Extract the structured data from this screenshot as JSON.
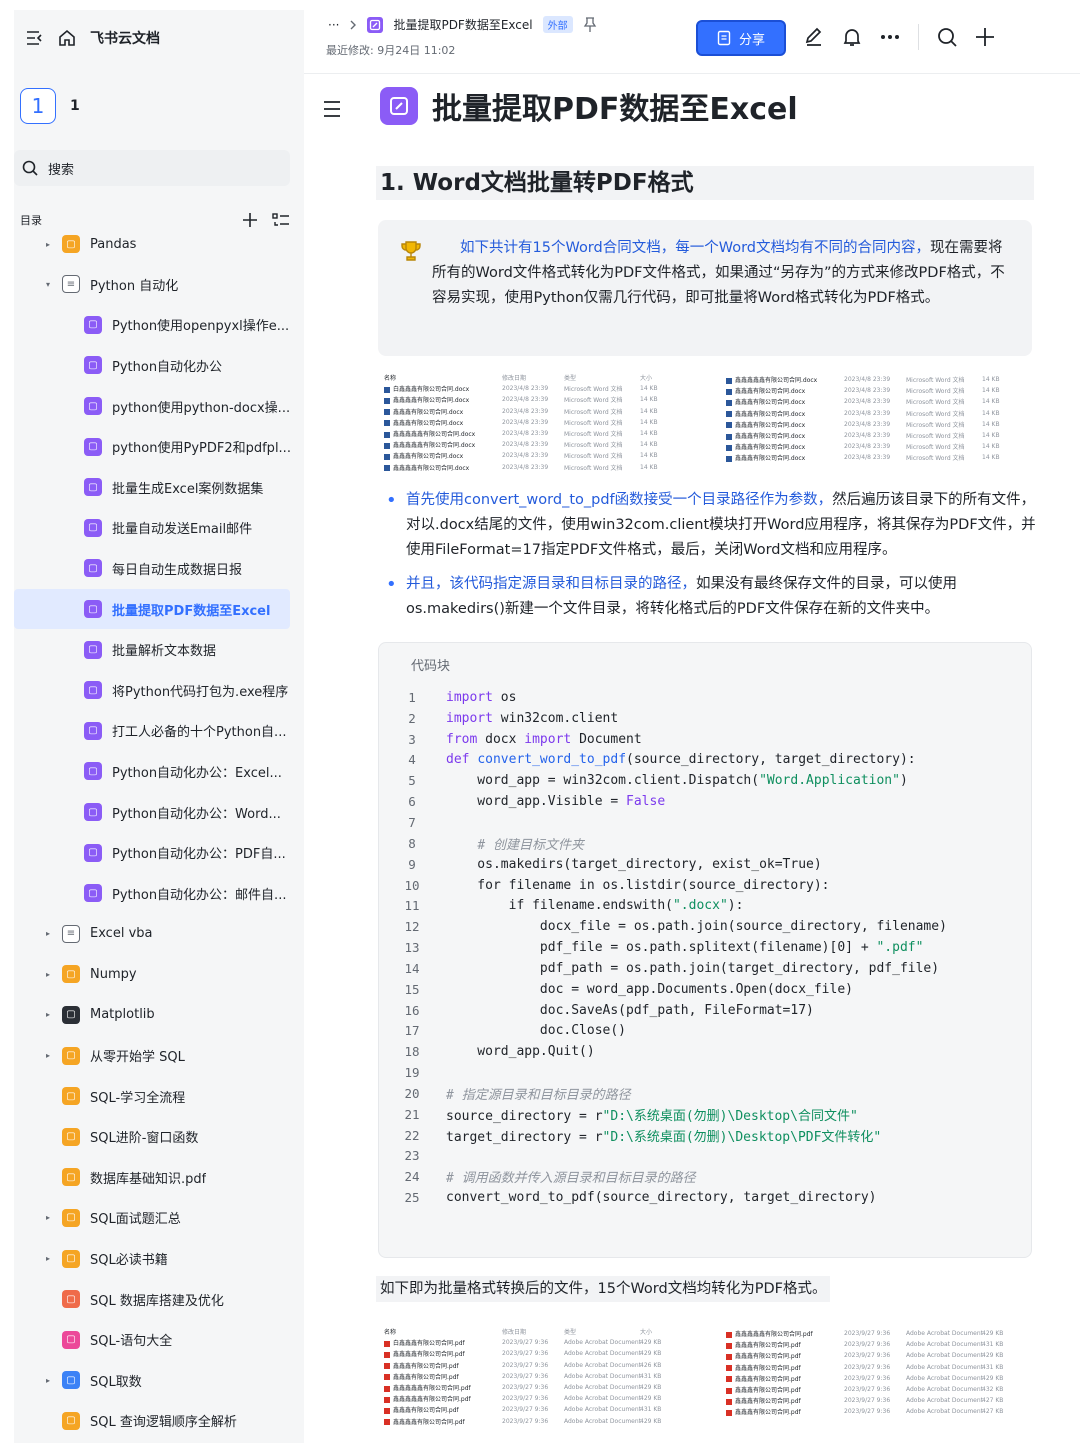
{
  "sidebar": {
    "title": "飞书云文档",
    "workspace_box": "1",
    "workspace_num": "1",
    "search_placeholder": "搜索",
    "toc_label": "目录",
    "items": [
      {
        "label": "Pandas",
        "level": 1,
        "arrow": "▸",
        "icon": "i-orange"
      },
      {
        "label": "Python 自动化",
        "level": 1,
        "arrow": "▾",
        "icon": "i-doc"
      },
      {
        "label": "Python使用openpyxl操作e...",
        "level": 2,
        "icon": "i-purple"
      },
      {
        "label": "Python自动化办公",
        "level": 2,
        "icon": "i-purple"
      },
      {
        "label": "python使用python-docx操...",
        "level": 2,
        "icon": "i-purple"
      },
      {
        "label": "python使用PyPDF2和pdfpl...",
        "level": 2,
        "icon": "i-purple"
      },
      {
        "label": "批量生成Excel案例数据集",
        "level": 2,
        "icon": "i-purple"
      },
      {
        "label": "批量自动发送Email邮件",
        "level": 2,
        "icon": "i-purple"
      },
      {
        "label": "每日自动生成数据日报",
        "level": 2,
        "icon": "i-purple"
      },
      {
        "label": "批量提取PDF数据至Excel",
        "level": 2,
        "icon": "i-purple",
        "selected": true
      },
      {
        "label": "批量解析文本数据",
        "level": 2,
        "icon": "i-purple"
      },
      {
        "label": "将Python代码打包为.exe程序",
        "level": 2,
        "icon": "i-purple"
      },
      {
        "label": "打工人必备的十个Python自...",
        "level": 2,
        "icon": "i-purple"
      },
      {
        "label": "Python自动化办公：Excel...",
        "level": 2,
        "icon": "i-purple"
      },
      {
        "label": "Python自动化办公：Word...",
        "level": 2,
        "icon": "i-purple"
      },
      {
        "label": "Python自动化办公：PDF自...",
        "level": 2,
        "icon": "i-purple"
      },
      {
        "label": "Python自动化办公：邮件自...",
        "level": 2,
        "icon": "i-purple"
      },
      {
        "label": "Excel vba",
        "level": 1,
        "arrow": "▸",
        "icon": "i-doc"
      },
      {
        "label": "Numpy",
        "level": 1,
        "arrow": "▸",
        "icon": "i-orange"
      },
      {
        "label": "Matplotlib",
        "level": 1,
        "arrow": "▸",
        "icon": "i-dark"
      },
      {
        "label": "从零开始学 SQL",
        "level": 1,
        "arrow": "▸",
        "icon": "i-orange"
      },
      {
        "label": "SQL-学习全流程",
        "level": 1,
        "icon": "i-orange"
      },
      {
        "label": "SQL进阶-窗口函数",
        "level": 1,
        "icon": "i-orange"
      },
      {
        "label": "数据库基础知识.pdf",
        "level": 1,
        "icon": "i-orange"
      },
      {
        "label": "SQL面试题汇总",
        "level": 1,
        "arrow": "▸",
        "icon": "i-orange"
      },
      {
        "label": "SQL必读书籍",
        "level": 1,
        "arrow": "▸",
        "icon": "i-orange"
      },
      {
        "label": "SQL 数据库搭建及优化",
        "level": 1,
        "icon": "i-red"
      },
      {
        "label": "SQL-语句大全",
        "level": 1,
        "icon": "i-pink"
      },
      {
        "label": "SQL取数",
        "level": 1,
        "arrow": "▸",
        "icon": "i-blue"
      },
      {
        "label": "SQL 查询逻辑顺序全解析",
        "level": 1,
        "icon": "i-orange"
      }
    ]
  },
  "header": {
    "ellipsis": "···",
    "crumb_title": "批量提取PDF数据至Excel",
    "external_badge": "外部",
    "modified": "最近修改: 9月24日 11:02",
    "share_label": "分享"
  },
  "doc": {
    "title": "批量提取PDF数据至Excel",
    "h2": "1. Word文档批量转PDF格式",
    "callout_blue": "如下共计有15个Word合同文档，每一个Word文档均有不同的合同内容，",
    "callout_rest": "现在需要将所有的Word文件格式转化为PDF文件格式，如果通过“另存为”的方式来修改PDF格式，不容易实现，使用Python仅需几行代码，即可批量将Word格式转化为PDF格式。",
    "bullet1_blue": "首先使用convert_word_to_pdf函数接受一个目录路径作为参数，",
    "bullet1_rest": "然后遍历该目录下的所有文件，对以.docx结尾的文件，使用win32com.client模块打开Word应用程序，将其保存为PDF文件，并使用FileFormat=17指定PDF文件格式，最后，关闭Word文档和应用程序。",
    "bullet2_blue": "并且，该代码指定源目录和目标目录的路径，",
    "bullet2_rest": "如果没有最终保存文件的目录，可以使用os.makedirs()新建一个文件目录，将转化格式后的PDF文件保存在新的文件夹中。",
    "code_title": "代码块",
    "para2": "如下即为批量格式转换后的文件，15个Word文档均转化为PDF格式。"
  },
  "code_lines": [
    "import os",
    "import win32com.client",
    "from docx import Document",
    "def convert_word_to_pdf(source_directory, target_directory):",
    "    word_app = win32com.client.Dispatch(\"Word.Application\")",
    "    word_app.Visible = False",
    "",
    "    # 创建目标文件夹",
    "    os.makedirs(target_directory, exist_ok=True)",
    "    for filename in os.listdir(source_directory):",
    "        if filename.endswith(\".docx\"):",
    "            docx_file = os.path.join(source_directory, filename)",
    "            pdf_file = os.path.splitext(filename)[0] + \".pdf\"",
    "            pdf_path = os.path.join(target_directory, pdf_file)",
    "            doc = word_app.Documents.Open(docx_file)",
    "            doc.SaveAs(pdf_path, FileFormat=17)",
    "            doc.Close()",
    "    word_app.Quit()",
    "",
    "# 指定源目录和目标目录的路径",
    "source_directory = r\"D:\\系统桌面(勿删)\\Desktop\\合同文件\"",
    "target_directory = r\"D:\\系统桌面(勿删)\\Desktop\\PDF文件转化\"",
    "",
    "# 调用函数并传入源目录和目标目录的路径",
    "convert_word_to_pdf(source_directory, target_directory)"
  ],
  "word_files": {
    "headers": [
      "名称",
      "修改日期",
      "类型",
      "大小"
    ],
    "left": [
      [
        "白鑫鑫鑫有限公司合同.docx",
        "2023/4/8 23:39",
        "Microsoft Word 文档",
        "14 KB"
      ],
      [
        "鑫鑫鑫鑫有限公司合同.docx",
        "2023/4/8 23:39",
        "Microsoft Word 文档",
        "14 KB"
      ],
      [
        "鑫鑫鑫有限公司合同.docx",
        "2023/4/8 23:39",
        "Microsoft Word 文档",
        "14 KB"
      ],
      [
        "鑫鑫鑫有限公司合同.docx",
        "2023/4/8 23:39",
        "Microsoft Word 文档",
        "14 KB"
      ],
      [
        "鑫鑫鑫鑫鑫有限公司合同.docx",
        "2023/4/8 23:39",
        "Microsoft Word 文档",
        "14 KB"
      ],
      [
        "鑫鑫鑫鑫鑫有限公司合同.docx",
        "2023/4/8 23:39",
        "Microsoft Word 文档",
        "14 KB"
      ],
      [
        "鑫鑫鑫有限公司合同.docx",
        "2023/4/8 23:39",
        "Microsoft Word 文档",
        "14 KB"
      ],
      [
        "鑫鑫鑫鑫有限公司合同.docx",
        "2023/4/8 23:39",
        "Microsoft Word 文档",
        "14 KB"
      ]
    ],
    "right": [
      [
        "鑫鑫鑫鑫鑫有限公司合同.docx",
        "2023/4/8 23:39",
        "Microsoft Word 文档",
        "14 KB"
      ],
      [
        "鑫鑫鑫有限公司合同.docx",
        "2023/4/8 23:39",
        "Microsoft Word 文档",
        "14 KB"
      ],
      [
        "鑫鑫鑫有限公司合同.docx",
        "2023/4/8 23:39",
        "Microsoft Word 文档",
        "14 KB"
      ],
      [
        "鑫鑫鑫有限公司合同.docx",
        "2023/4/8 23:39",
        "Microsoft Word 文档",
        "14 KB"
      ],
      [
        "鑫鑫鑫有限公司合同.docx",
        "2023/4/8 23:39",
        "Microsoft Word 文档",
        "14 KB"
      ],
      [
        "鑫鑫鑫有限公司合同.docx",
        "2023/4/8 23:39",
        "Microsoft Word 文档",
        "14 KB"
      ],
      [
        "鑫鑫鑫有限公司合同.docx",
        "2023/4/8 23:39",
        "Microsoft Word 文档",
        "14 KB"
      ],
      [
        "鑫鑫鑫有限公司合同.docx",
        "2023/4/8 23:39",
        "Microsoft Word 文档",
        "14 KB"
      ]
    ]
  },
  "pdf_files": {
    "headers": [
      "名称",
      "修改日期",
      "类型",
      "大小"
    ],
    "left": [
      [
        "白鑫鑫鑫有限公司合同.pdf",
        "2023/9/27 9:36",
        "Adobe Acrobat Document",
        "429 KB"
      ],
      [
        "鑫鑫鑫鑫有限公司合同.pdf",
        "2023/9/27 9:36",
        "Adobe Acrobat Document",
        "429 KB"
      ],
      [
        "鑫鑫鑫有限公司合同.pdf",
        "2023/9/27 9:36",
        "Adobe Acrobat Document",
        "426 KB"
      ],
      [
        "鑫鑫鑫有限公司合同.pdf",
        "2023/9/27 9:36",
        "Adobe Acrobat Document",
        "431 KB"
      ],
      [
        "鑫鑫鑫鑫鑫有限公司合同.pdf",
        "2023/9/27 9:36",
        "Adobe Acrobat Document",
        "429 KB"
      ],
      [
        "鑫鑫鑫鑫鑫有限公司合同.pdf",
        "2023/9/27 9:36",
        "Adobe Acrobat Document",
        "429 KB"
      ],
      [
        "鑫鑫鑫有限公司合同.pdf",
        "2023/9/27 9:36",
        "Adobe Acrobat Document",
        "431 KB"
      ],
      [
        "鑫鑫鑫鑫有限公司合同.pdf",
        "2023/9/27 9:36",
        "Adobe Acrobat Document",
        "429 KB"
      ]
    ],
    "right": [
      [
        "鑫鑫鑫鑫鑫有限公司合同.pdf",
        "2023/9/27 9:36",
        "Adobe Acrobat Document",
        "429 KB"
      ],
      [
        "鑫鑫鑫有限公司合同.pdf",
        "2023/9/27 9:36",
        "Adobe Acrobat Document",
        "431 KB"
      ],
      [
        "鑫鑫鑫有限公司合同.pdf",
        "2023/9/27 9:36",
        "Adobe Acrobat Document",
        "429 KB"
      ],
      [
        "鑫鑫鑫有限公司合同.pdf",
        "2023/9/27 9:36",
        "Adobe Acrobat Document",
        "431 KB"
      ],
      [
        "鑫鑫鑫有限公司合同.pdf",
        "2023/9/27 9:36",
        "Adobe Acrobat Document",
        "429 KB"
      ],
      [
        "鑫鑫鑫有限公司合同.pdf",
        "2023/9/27 9:36",
        "Adobe Acrobat Document",
        "432 KB"
      ],
      [
        "鑫鑫鑫有限公司合同.pdf",
        "2023/9/27 9:36",
        "Adobe Acrobat Document",
        "427 KB"
      ],
      [
        "鑫鑫鑫有限公司合同.pdf",
        "2023/9/27 9:36",
        "Adobe Acrobat Document",
        "427 KB"
      ]
    ]
  },
  "colors": {
    "accent": "#3370ff",
    "selected_bg": "#e1eaff",
    "purple_icon": "#8b5cf6"
  }
}
